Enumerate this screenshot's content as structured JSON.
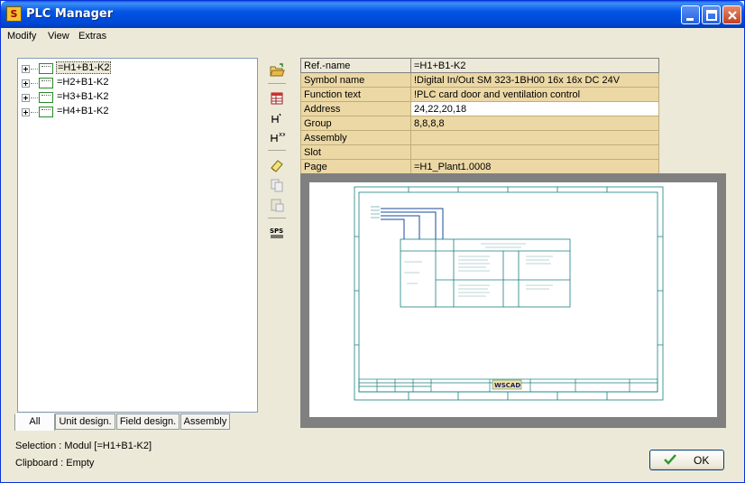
{
  "window": {
    "title": "PLC Manager",
    "app_icon": "S"
  },
  "menu": [
    "Modify",
    "View",
    "Extras"
  ],
  "tree": {
    "items": [
      "=H1+B1-K2",
      "=H2+B1-K2",
      "=H3+B1-K2",
      "=H4+B1-K2"
    ],
    "selected_index": 0
  },
  "tabs": [
    "All",
    "Unit design.",
    "Field design.",
    "Assembly"
  ],
  "toolbar": {
    "icons": [
      "open-folder-icon",
      "table-icon",
      "symbol-icon",
      "symbol-plus-icon",
      "eraser-icon",
      "copy-icon",
      "paste-icon",
      "sps-icon"
    ],
    "sps_label": "SPS"
  },
  "properties": {
    "header": {
      "key": "Ref.-name",
      "value": "=H1+B1-K2"
    },
    "rows": [
      {
        "key": "Symbol name",
        "value": "!Digital In/Out SM 323-1BH00 16x 16x DC 24V"
      },
      {
        "key": "Function text",
        "value": "!PLC card door and ventilation control"
      },
      {
        "key": "Address",
        "value": "24,22,20,18"
      },
      {
        "key": "Group",
        "value": "8,8,8,8"
      },
      {
        "key": "Assembly",
        "value": ""
      },
      {
        "key": "Slot",
        "value": ""
      },
      {
        "key": "Page",
        "value": "=H1_Plant1.0008"
      }
    ],
    "editing_index": 2
  },
  "preview": {
    "logo_text": "WSCAD"
  },
  "status": {
    "selection": "Selection : Modul [=H1+B1-K2]",
    "clipboard": "Clipboard : Empty"
  },
  "ok_button": {
    "label": "OK"
  },
  "colors": {
    "title_blue": "#0055e5",
    "property_bg": "#ecd8a5",
    "drawing_teal": "#1a7f7f"
  }
}
